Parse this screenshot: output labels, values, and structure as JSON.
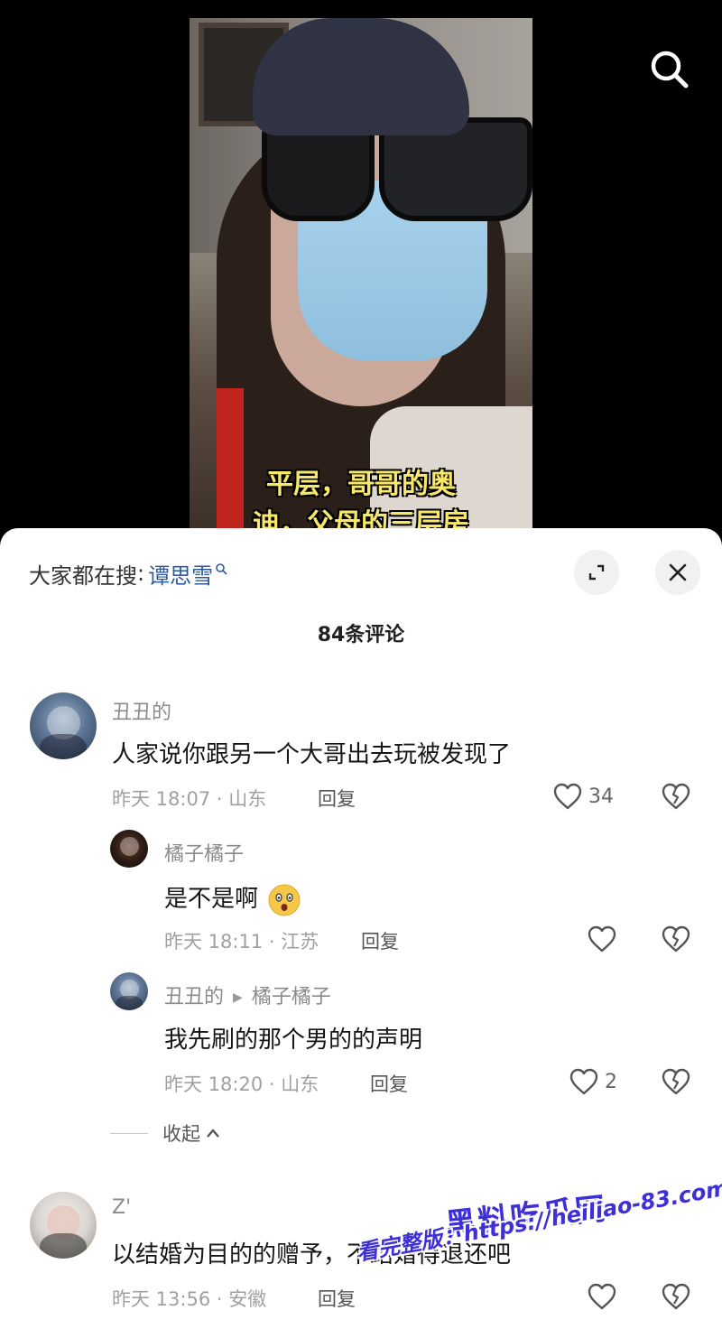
{
  "video": {
    "caption_line1": "平层，哥哥的奥",
    "caption_line2": "迪，父母的三层房"
  },
  "panel": {
    "trend_label": "大家都在搜",
    "trend_sep": ":",
    "trend_keyword": "谭思雪",
    "comment_count": "84条评论"
  },
  "comments": [
    {
      "user": "丑丑的",
      "text": "人家说你跟另一个大哥出去玩被发现了",
      "time_location": "昨天 18:07 · 山东",
      "reply_label": "回复",
      "likes": "34",
      "replies": [
        {
          "user": "橘子橘子",
          "text": "是不是啊",
          "time_location": "昨天 18:11 · 江苏",
          "reply_label": "回复",
          "likes": ""
        },
        {
          "user": "丑丑的",
          "reply_to": "橘子橘子",
          "text": "我先刷的那个男的的声明",
          "time_location": "昨天 18:20 · 山东",
          "reply_label": "回复",
          "likes": "2"
        }
      ],
      "collapse_label": "收起"
    },
    {
      "user": "Z'",
      "text": "以结婚为目的的赠予，不结婚得退还吧",
      "time_location": "昨天 13:56 · 安徽",
      "reply_label": "回复",
      "likes": ""
    }
  ],
  "watermark": {
    "title": "黑料吃瓜网",
    "url": "看完整版：https://heiliao-83.com"
  },
  "icons": {
    "search": "search-icon",
    "expand": "expand-icon",
    "close": "close-icon",
    "like": "heart-outline-icon",
    "dislike": "broken-heart-icon",
    "collapse": "chevron-up-icon"
  },
  "colors": {
    "accent_link": "#2b5a9e",
    "caption_yellow": "#f8e86a",
    "watermark": "#3e2fd8"
  }
}
